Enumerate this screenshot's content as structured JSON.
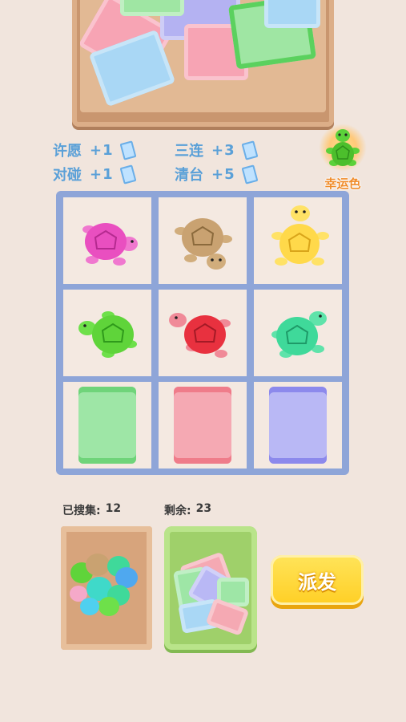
{
  "rewards": [
    {
      "name": "许愿",
      "amount": "+1"
    },
    {
      "name": "三连",
      "amount": "+3"
    },
    {
      "name": "对碰",
      "amount": "+1"
    },
    {
      "name": "清台",
      "amount": "+5"
    }
  ],
  "lucky_color": {
    "label": "幸运色",
    "turtle_color": "#5bd13a"
  },
  "grid": {
    "turtles": [
      {
        "color": "#e94fc0"
      },
      {
        "color": "#c9a271"
      },
      {
        "color": "#ffd94a"
      },
      {
        "color": "#5fd43a"
      },
      {
        "color": "#e8313f"
      },
      {
        "color": "#3fd99a"
      }
    ],
    "packets": [
      {
        "color": "#9ee6a6"
      },
      {
        "color": "#f5a9b3"
      },
      {
        "color": "#b9b8f5"
      }
    ]
  },
  "collected": {
    "label": "已搜集:",
    "value": "12"
  },
  "remaining": {
    "label": "剩余:",
    "value": "23"
  },
  "send_button": {
    "label": "派发"
  }
}
